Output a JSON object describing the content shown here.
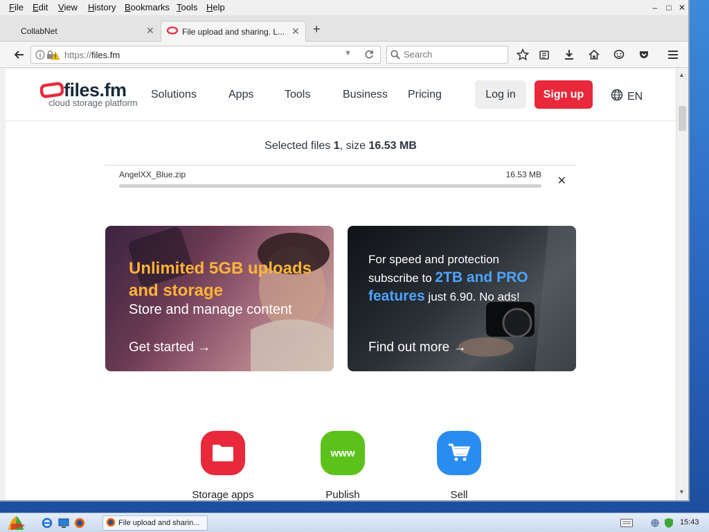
{
  "menubar": {
    "items": [
      {
        "label": "File",
        "u": "F",
        "rest": "ile"
      },
      {
        "label": "Edit",
        "u": "E",
        "rest": "dit"
      },
      {
        "label": "View",
        "u": "V",
        "rest": "iew"
      },
      {
        "label": "History",
        "u": "H",
        "rest": "istory"
      },
      {
        "label": "Bookmarks",
        "u": "B",
        "rest": "ookmarks"
      },
      {
        "label": "Tools",
        "u": "T",
        "rest": "ools"
      },
      {
        "label": "Help",
        "u": "H",
        "rest": "elp"
      }
    ]
  },
  "tabs": [
    {
      "label": "CollabNet",
      "active": false
    },
    {
      "label": "File upload and sharing. L...",
      "active": true
    }
  ],
  "navbar": {
    "url_scheme": "https://",
    "url_host": "files.fm",
    "search_placeholder": "Search"
  },
  "site": {
    "brand": "files.fm",
    "tagline": "cloud storage platform",
    "nav": [
      "Solutions",
      "Apps",
      "Tools",
      "Business",
      "Pricing"
    ],
    "login": "Log in",
    "signup": "Sign up",
    "lang": "EN",
    "colors": {
      "signup": "#e8293b",
      "accent_orange": "#ffb43a",
      "accent_blue": "#4ea3ff"
    }
  },
  "selection": {
    "prefix": "Selected files ",
    "count": "1",
    "mid": ", size ",
    "size": "16.53 MB"
  },
  "file": {
    "name": "AngelXX_Blue.zip",
    "size": "16.53 MB",
    "progress": 1.0
  },
  "promo1": {
    "headline": "Unlimited 5GB uploads and storage",
    "sub": "Store and manage content",
    "cta": "Get started"
  },
  "promo2": {
    "line1": "For speed and protection",
    "line2a": "subscribe to ",
    "line2b": "2TB and PRO",
    "line3a": "features",
    "line3b": " just 6.90. No ads!",
    "cta": "Find out more"
  },
  "features": [
    {
      "label": "Storage apps",
      "color": "#e8293b",
      "icon": "folder-icon"
    },
    {
      "label": "Publish",
      "color": "#5cc21b",
      "icon": "www-icon",
      "icon_text": "www"
    },
    {
      "label": "Sell",
      "color": "#2a8cf0",
      "icon": "cart-icon"
    }
  ],
  "taskbar": {
    "task_label": "File upload and sharin...",
    "clock": "15:43"
  }
}
